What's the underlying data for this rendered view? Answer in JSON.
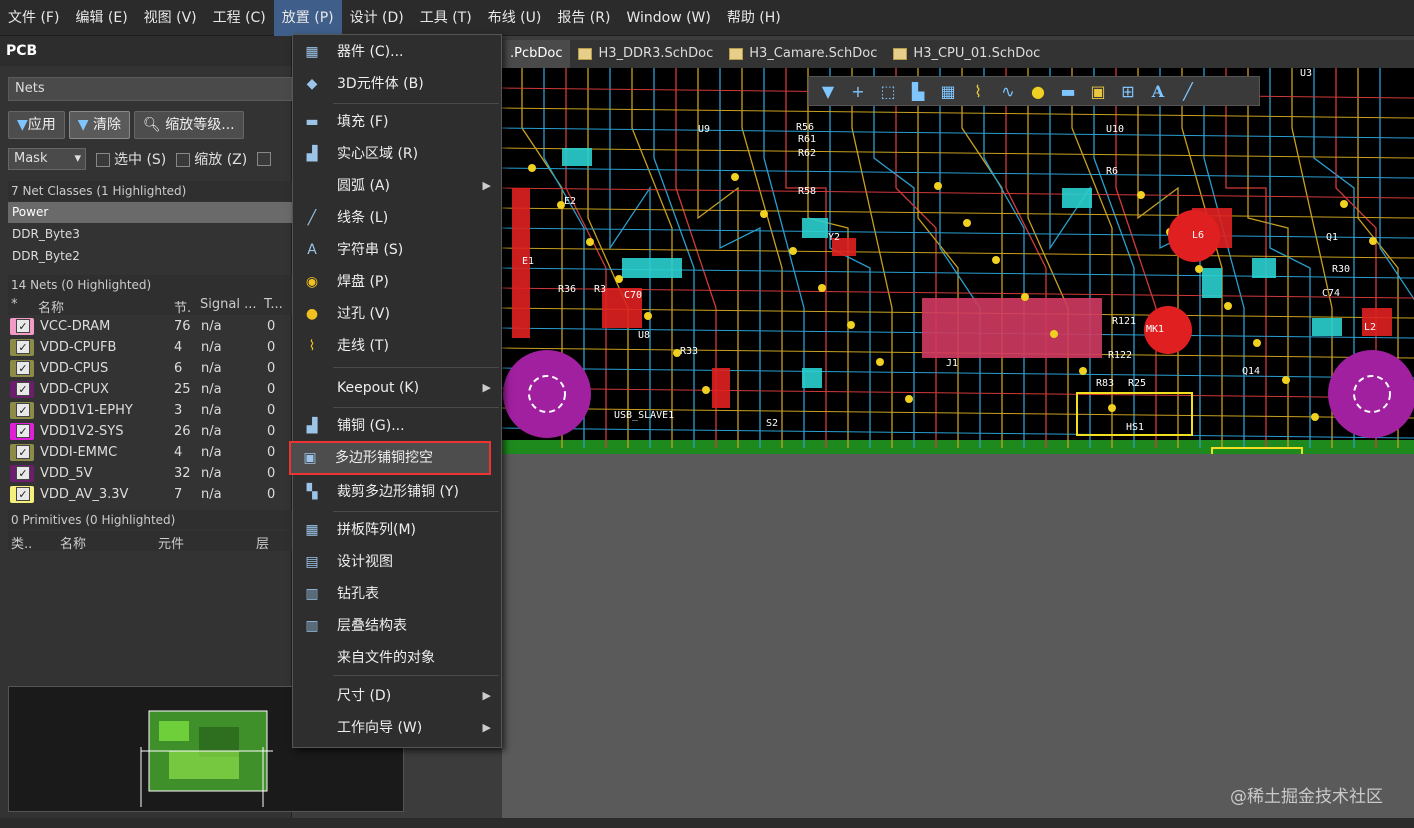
{
  "menubar": {
    "items": [
      "文件 (F)",
      "编辑 (E)",
      "视图 (V)",
      "工程 (C)",
      "放置 (P)",
      "设计 (D)",
      "工具 (T)",
      "布线 (U)",
      "报告 (R)",
      "Window (W)",
      "帮助 (H)"
    ],
    "active_index": 4
  },
  "panel": {
    "title": "PCB",
    "nets_select": "Nets",
    "buttons": {
      "apply": "应用",
      "clear": "清除",
      "zoom": "缩放等级..."
    },
    "mask": "Mask",
    "select_label": "选中 (S)",
    "zoom_label": "缩放 (Z)",
    "classes_header": "7 Net Classes (1 Highlighted)",
    "classes": [
      "Power",
      "DDR_Byte3",
      "DDR_Byte2"
    ],
    "nets_header": "14 Nets (0 Highlighted)",
    "net_columns": {
      "star": "*",
      "name": "名称",
      "nodes": "节.",
      "signal": "Signal ...",
      "t": "T..."
    },
    "nets": [
      {
        "name": "VCC-DRAM",
        "nodes": "76",
        "signal": "n/a",
        "t": "0",
        "color": "#f29bc4"
      },
      {
        "name": "VDD-CPUFB",
        "nodes": "4",
        "signal": "n/a",
        "t": "0",
        "color": "#8c8c48"
      },
      {
        "name": "VDD-CPUS",
        "nodes": "6",
        "signal": "n/a",
        "t": "0",
        "color": "#8c8c48"
      },
      {
        "name": "VDD-CPUX",
        "nodes": "25",
        "signal": "n/a",
        "t": "0",
        "color": "#6b1e6b"
      },
      {
        "name": "VDD1V1-EPHY",
        "nodes": "3",
        "signal": "n/a",
        "t": "0",
        "color": "#8c8c48"
      },
      {
        "name": "VDD1V2-SYS",
        "nodes": "26",
        "signal": "n/a",
        "t": "0",
        "color": "#e020d8"
      },
      {
        "name": "VDDI-EMMC",
        "nodes": "4",
        "signal": "n/a",
        "t": "0",
        "color": "#8c8c48"
      },
      {
        "name": "VDD_5V",
        "nodes": "32",
        "signal": "n/a",
        "t": "0",
        "color": "#6b1e6b"
      },
      {
        "name": "VDD_AV_3.3V",
        "nodes": "7",
        "signal": "n/a",
        "t": "0",
        "color": "#f5f07a"
      }
    ],
    "primitives_header": "0 Primitives (0 Highlighted)",
    "prim_columns": {
      "type": "类..",
      "name": "名称",
      "component": "元件",
      "layer": "层"
    }
  },
  "tabs": [
    {
      "label": ".PcbDoc",
      "active": true
    },
    {
      "label": "H3_DDR3.SchDoc",
      "active": false
    },
    {
      "label": "H3_Camare.SchDoc",
      "active": false
    },
    {
      "label": "H3_CPU_01.SchDoc",
      "active": false
    }
  ],
  "dropdown": {
    "items": [
      {
        "label": "器件 (C)...",
        "icon": "chip-icon"
      },
      {
        "label": "3D元件体 (B)",
        "icon": "3d-body-icon"
      },
      {
        "label": "填充 (F)",
        "icon": "fill-icon"
      },
      {
        "label": "实心区域 (R)",
        "icon": "solid-region-icon"
      },
      {
        "label": "圆弧 (A)",
        "icon": "",
        "submenu": true
      },
      {
        "label": "线条 (L)",
        "icon": "line-icon"
      },
      {
        "label": "字符串 (S)",
        "icon": "text-icon"
      },
      {
        "label": "焊盘 (P)",
        "icon": "pad-icon"
      },
      {
        "label": "过孔 (V)",
        "icon": "via-icon"
      },
      {
        "label": "走线 (T)",
        "icon": "track-icon"
      },
      {
        "label": "Keepout (K)",
        "icon": "",
        "submenu": true
      },
      {
        "label": "铺铜 (G)...",
        "icon": "polygon-pour-icon"
      },
      {
        "label": "多边形铺铜挖空",
        "icon": "polygon-cutout-icon",
        "highlight": true
      },
      {
        "label": "裁剪多边形铺铜 (Y)",
        "icon": "slice-polygon-icon"
      },
      {
        "label": "拼板阵列(M)",
        "icon": "panel-array-icon"
      },
      {
        "label": "设计视图",
        "icon": "design-view-icon"
      },
      {
        "label": "钻孔表",
        "icon": "drill-table-icon"
      },
      {
        "label": "层叠结构表",
        "icon": "layer-stack-icon"
      },
      {
        "label": "来自文件的对象",
        "icon": ""
      },
      {
        "label": "尺寸 (D)",
        "icon": "",
        "submenu": true
      },
      {
        "label": "工作向导 (W)",
        "icon": "",
        "submenu": true
      }
    ]
  },
  "pcb_labels": [
    "E2",
    "E1",
    "U8",
    "R33",
    "R36",
    "R3",
    "C70",
    "USB_SLAVE1",
    "S2",
    "Y2",
    "L6",
    "Q1",
    "R30",
    "C74",
    "L2",
    "MK1",
    "R83",
    "R25",
    "HS1",
    "Q14",
    "R122",
    "R121",
    "U3",
    "R6",
    "R56",
    "R61",
    "R58",
    "U9",
    "R62",
    "U10",
    "J1"
  ],
  "watermark": "@稀土掘金技术社区",
  "colors": {
    "highlight_outline": "#e33333",
    "menu_active": "#3f5f8a"
  }
}
